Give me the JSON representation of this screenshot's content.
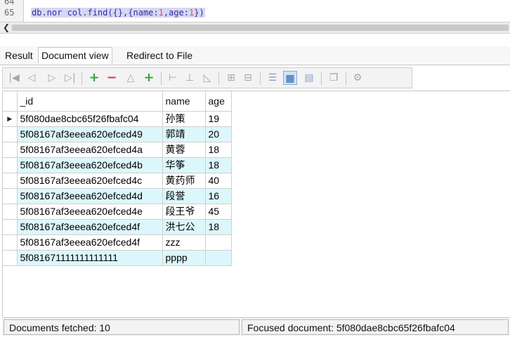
{
  "editor": {
    "lines": [
      {
        "number": "64",
        "code": ""
      },
      {
        "number": "65",
        "code_prefix": "db.nor col.find({},{name:",
        "num1": "1",
        "mid": ",age:",
        "num2": "1",
        "code_suffix": "})"
      }
    ]
  },
  "tabs": [
    {
      "label": "Result",
      "active": false
    },
    {
      "label": "Document view",
      "active": true
    },
    {
      "label": "Redirect to File",
      "active": false
    }
  ],
  "toolbar": {
    "icons": [
      "first-icon",
      "prev-icon",
      "next-icon",
      "last-icon",
      "add-icon",
      "remove-icon",
      "up-icon",
      "add-green-icon",
      "insert-icon",
      "remove-line-icon",
      "indent-icon",
      "expand-icon",
      "collapse-icon",
      "tree-view-icon",
      "grid-view-icon",
      "text-view-icon",
      "copy-icon",
      "settings-icon"
    ]
  },
  "grid": {
    "columns": [
      "_id",
      "name",
      "age"
    ],
    "rows": [
      {
        "id": "5f080dae8cbc65f26fbafc04",
        "name": "孙策",
        "age": "19",
        "current": true
      },
      {
        "id": "5f08167af3eeea620efced49",
        "name": "郭靖",
        "age": "20"
      },
      {
        "id": "5f08167af3eeea620efced4a",
        "name": "黄蓉",
        "age": "18"
      },
      {
        "id": "5f08167af3eeea620efced4b",
        "name": "华筝",
        "age": "18"
      },
      {
        "id": "5f08167af3eeea620efced4c",
        "name": "黄药师",
        "age": "40"
      },
      {
        "id": "5f08167af3eeea620efced4d",
        "name": "段誉",
        "age": "16"
      },
      {
        "id": "5f08167af3eeea620efced4e",
        "name": "段王爷",
        "age": "45"
      },
      {
        "id": "5f08167af3eeea620efced4f",
        "name": "洪七公",
        "age": "18"
      },
      {
        "id": "5f08167af3eeea620efced4f",
        "name": "zzz",
        "age": ""
      },
      {
        "id": "5f081671111111111111",
        "name": "pppp",
        "age": ""
      }
    ]
  },
  "status": {
    "left": "Documents fetched: 10",
    "right": "Focused document: 5f080dae8cbc65f26fbafc04"
  }
}
